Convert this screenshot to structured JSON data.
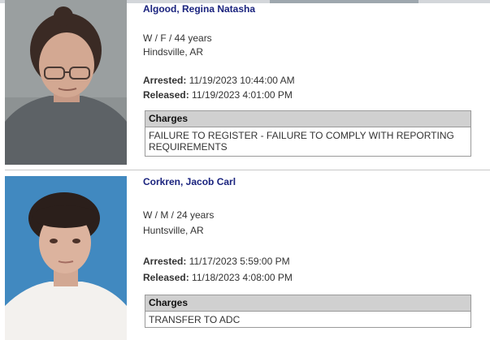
{
  "records": [
    {
      "name": "Algood, Regina Natasha",
      "demographics": "W / F / 44 years",
      "city": "Hindsville, AR",
      "arrested_label": "Arrested:",
      "arrested": "11/19/2023 10:44:00 AM",
      "released_label": "Released:",
      "released": "11/19/2023 4:01:00 PM",
      "charges_header": "Charges",
      "charges": "FAILURE TO REGISTER - FAILURE TO COMPLY WITH REPORTING REQUIREMENTS"
    },
    {
      "name": "Corkren, Jacob Carl",
      "demographics": "W / M / 24 years",
      "city": "Huntsville, AR",
      "arrested_label": "Arrested:",
      "arrested": "11/17/2023 5:59:00 PM",
      "released_label": "Released:",
      "released": "11/18/2023 4:08:00 PM",
      "charges_header": "Charges",
      "charges": "TRANSFER TO ADC"
    }
  ]
}
